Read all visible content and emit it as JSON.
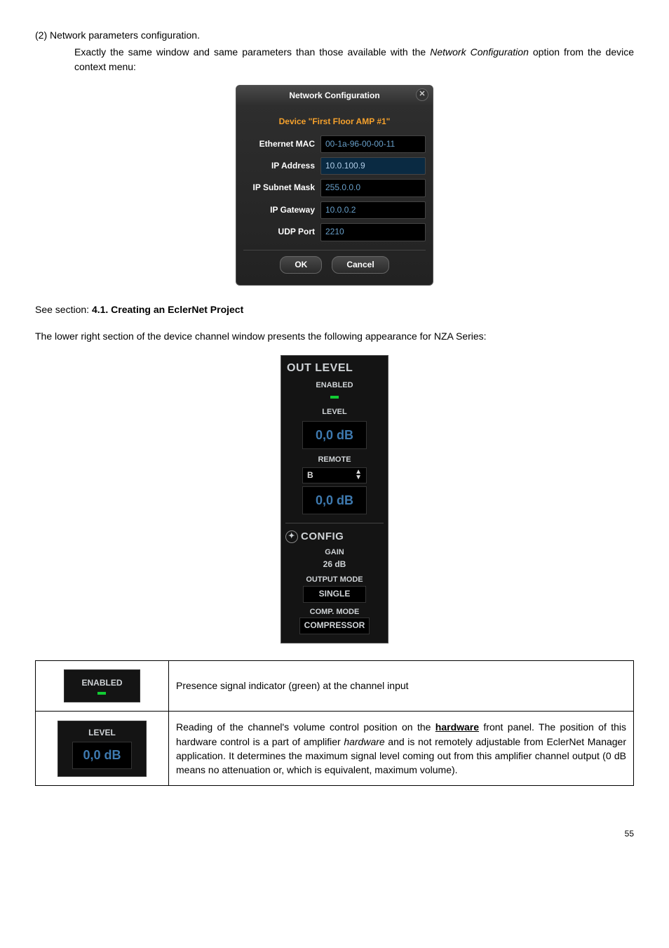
{
  "heading": "(2) Network parameters configuration.",
  "intro_pre": "Exactly the same window and same parameters than those available with the ",
  "intro_italic": "Network Configuration",
  "intro_post": " option from the device context menu:",
  "netconf": {
    "title": "Network Configuration",
    "device_line": "Device \"First Floor AMP #1\"",
    "rows": [
      {
        "label": "Ethernet MAC",
        "value": "00-1a-96-00-00-11"
      },
      {
        "label": "IP Address",
        "value": "10.0.100.9",
        "hl": true
      },
      {
        "label": "IP Subnet Mask",
        "value": "255.0.0.0"
      },
      {
        "label": "IP Gateway",
        "value": "10.0.0.2"
      },
      {
        "label": "UDP Port",
        "value": "2210"
      }
    ],
    "ok": "OK",
    "cancel": "Cancel"
  },
  "see_pre": "See section: ",
  "see_bold": "4.1. Creating an EclerNet Project",
  "lower_para": "The lower right section of the device channel window presents the following appearance for NZA Series:",
  "outpanel": {
    "title": "OUT LEVEL",
    "enabled": "ENABLED",
    "level_label": "LEVEL",
    "level_val": "0,0 dB",
    "remote_label": "REMOTE",
    "remote_sel": "B",
    "remote_val": "0,0 dB",
    "config_title": "CONFIG",
    "gain_label": "GAIN",
    "gain_val": "26 dB",
    "outmode_label": "OUTPUT MODE",
    "outmode_val": "SINGLE",
    "compmode_label": "COMP. MODE",
    "compmode_val": "COMPRESSOR"
  },
  "table": {
    "enabled_label": "ENABLED",
    "enabled_desc": "Presence signal indicator (green) at the channel input",
    "level_label": "LEVEL",
    "level_val": "0,0 dB",
    "level_desc_1": "Reading of the channel's volume control position on the ",
    "level_desc_hw": "hardware",
    "level_desc_2": " front panel. The position of this hardware control is a part of amplifier ",
    "level_desc_hw2": "hardware",
    "level_desc_3": "  and is not remotely adjustable from EclerNet Manager application. It determines the maximum signal level coming out from this amplifier channel output (0 dB means no attenuation or, which is equivalent, maximum volume)."
  },
  "page": "55"
}
